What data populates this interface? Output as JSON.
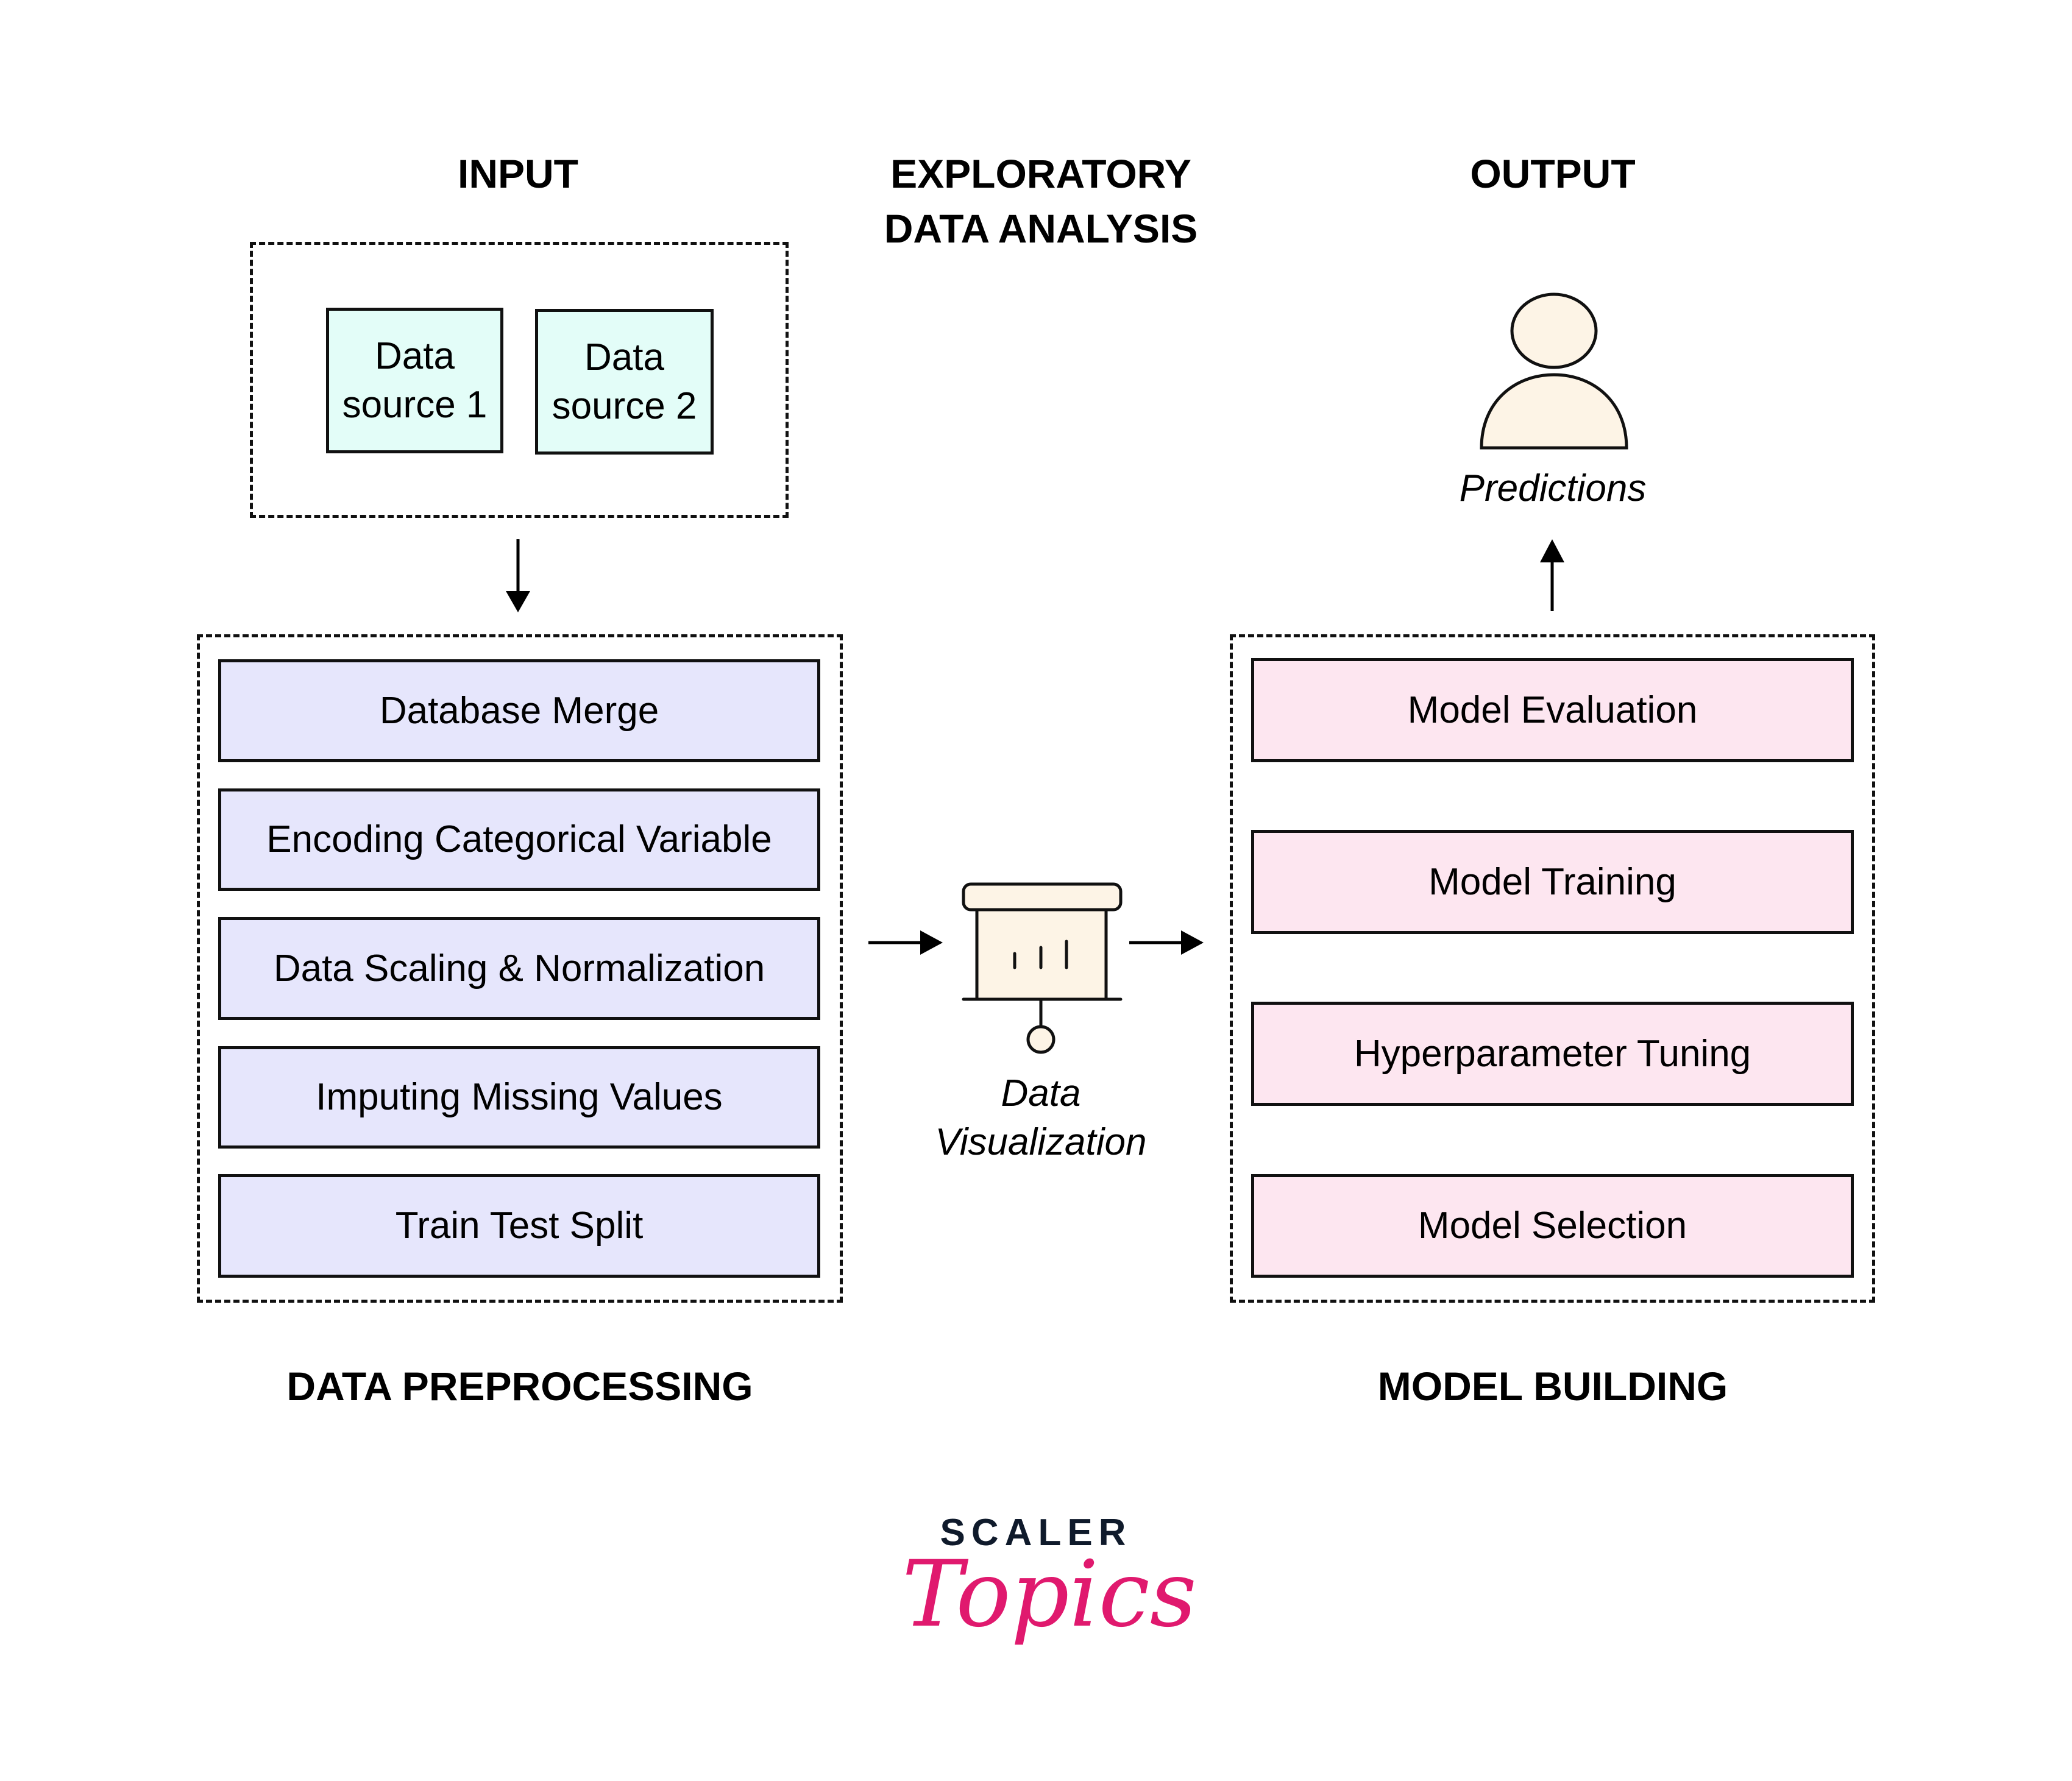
{
  "headings": {
    "input": "INPUT",
    "eda_line1": "EXPLORATORY",
    "eda_line2": "DATA ANALYSIS",
    "output": "OUTPUT",
    "preprocessing": "DATA PREPROCESSING",
    "model_building": "MODEL BUILDING"
  },
  "input": {
    "sources": [
      {
        "line1": "Data",
        "line2": "source 1"
      },
      {
        "line1": "Data",
        "line2": "source 2"
      }
    ]
  },
  "preprocessing": {
    "steps": [
      "Database Merge",
      "Encoding Categorical Variable",
      "Data Scaling & Normalization",
      "Imputing Missing Values",
      "Train Test Split"
    ]
  },
  "eda": {
    "icon": "presentation-chart-icon",
    "caption_line1": "Data",
    "caption_line2": "Visualization"
  },
  "model_building": {
    "steps": [
      "Model Evaluation",
      "Model Training",
      "Hyperparameter Tuning",
      "Model Selection"
    ]
  },
  "output": {
    "icon": "user-icon",
    "caption": "Predictions"
  },
  "logo": {
    "brand": "SCALER",
    "sub": "Topics"
  },
  "colors": {
    "source_fill": "#e3fdf8",
    "preprocessing_fill": "#e6e6fc",
    "model_fill": "#fde6f0",
    "icon_fill": "#fdf4e6",
    "logo_dark": "#0f1a2b",
    "logo_pink": "#e0196e"
  }
}
